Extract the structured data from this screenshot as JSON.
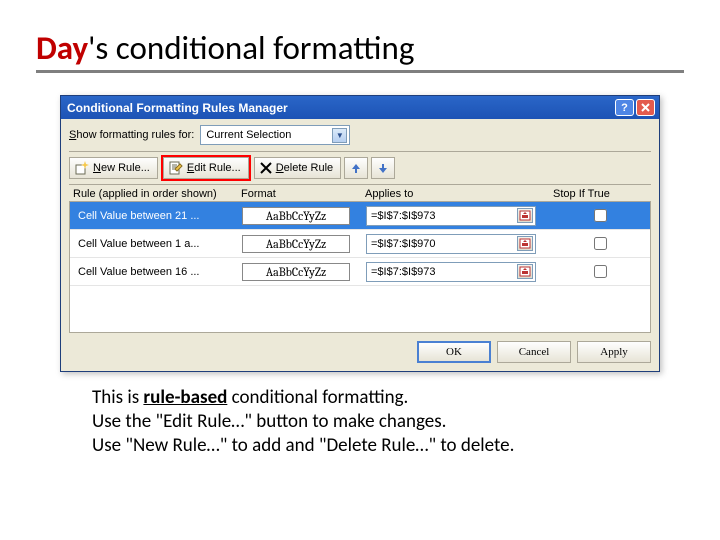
{
  "slide": {
    "title_prefix": "Day",
    "title_suffix": "'s conditional formatting"
  },
  "dialog": {
    "title": "Conditional Formatting Rules Manager",
    "show_label_pre": "S",
    "show_label_post": "how formatting rules for:",
    "show_value": "Current Selection",
    "buttons": {
      "new_pre": "N",
      "new_post": "ew Rule...",
      "edit_pre": "E",
      "edit_post": "dit Rule...",
      "del_pre": "D",
      "del_post": "elete Rule"
    },
    "headers": {
      "rule": "Rule (applied in order shown)",
      "format": "Format",
      "applies": "Applies to",
      "stop_pre": "Stop ",
      "stop_u": "I",
      "stop_post": "f True"
    },
    "preview_text": "AaBbCcYyZz",
    "rules": [
      {
        "name": "Cell Value between 21 ...",
        "applies": "=$I$7:$I$973",
        "checked": false,
        "selected": true
      },
      {
        "name": "Cell Value between 1 a...",
        "applies": "=$I$7:$I$970",
        "checked": false,
        "selected": false
      },
      {
        "name": "Cell Value between 16 ...",
        "applies": "=$I$7:$I$973",
        "checked": false,
        "selected": false
      }
    ],
    "footer": {
      "ok": "OK",
      "cancel": "Cancel",
      "apply": "Apply"
    }
  },
  "caption": {
    "l1a": "This is ",
    "l1b": "rule-based",
    "l1c": " conditional formatting.",
    "l2": "Use the \"Edit Rule…\" button to make changes.",
    "l3": "Use \"New Rule…\" to add and \"Delete Rule…\" to delete."
  }
}
